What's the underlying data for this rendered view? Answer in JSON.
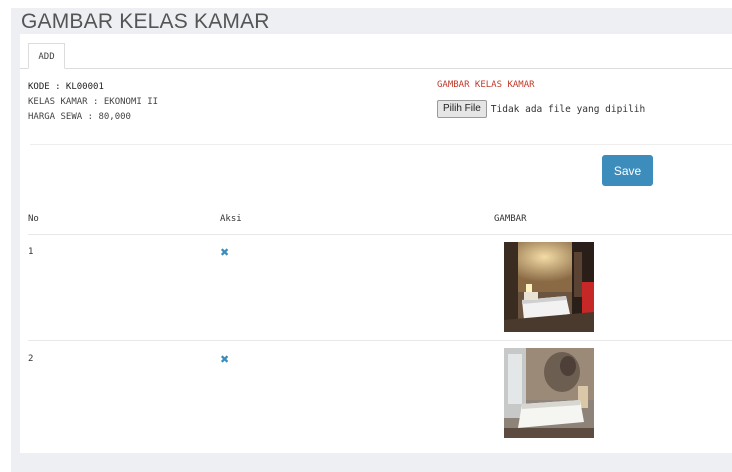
{
  "page": {
    "title": "GAMBAR KELAS KAMAR"
  },
  "tabs": [
    {
      "label": "ADD"
    }
  ],
  "form": {
    "kode": "KODE : KL00001",
    "kelas_kamar": "KELAS KAMAR : EKONOMI II",
    "harga_sewa": "HARGA SEWA : 80,000",
    "gambar_label": "GAMBAR KELAS KAMAR",
    "file_button": "Pilih File",
    "file_status": "Tidak ada file yang dipilih",
    "save_label": "Save"
  },
  "table": {
    "columns": [
      "No",
      "Aksi",
      "GAMBAR"
    ],
    "rows": [
      {
        "no": "1",
        "delete_icon": "close-icon"
      },
      {
        "no": "2",
        "delete_icon": "close-icon"
      }
    ]
  },
  "colors": {
    "accent": "#3c8dbc",
    "label_red": "#c0392b",
    "background": "#edeff2"
  }
}
